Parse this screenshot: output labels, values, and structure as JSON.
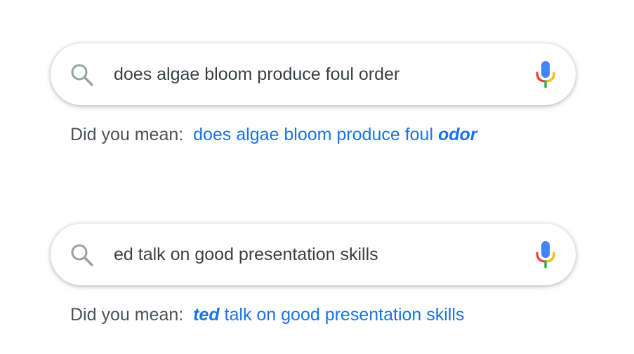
{
  "searches": [
    {
      "query": "does algae bloom produce foul order",
      "suggestion_prefix": "Did you mean:",
      "suggestion_before": "does algae bloom produce foul ",
      "suggestion_correction": "odor",
      "suggestion_after": ""
    },
    {
      "query": "ed talk on good presentation skills",
      "suggestion_prefix": "Did you mean:",
      "suggestion_before": "",
      "suggestion_correction": "ted",
      "suggestion_after": " talk on good presentation skills"
    }
  ],
  "icons": {
    "search": "search-icon",
    "mic": "mic-icon"
  },
  "colors": {
    "link": "#1a73e8",
    "text": "#4d5156",
    "query_text": "#3c4043",
    "mic_blue": "#4285f4",
    "mic_red": "#ea4335",
    "mic_yellow": "#fbbc04",
    "mic_green": "#34a853",
    "search_icon": "#9aa0a6"
  }
}
